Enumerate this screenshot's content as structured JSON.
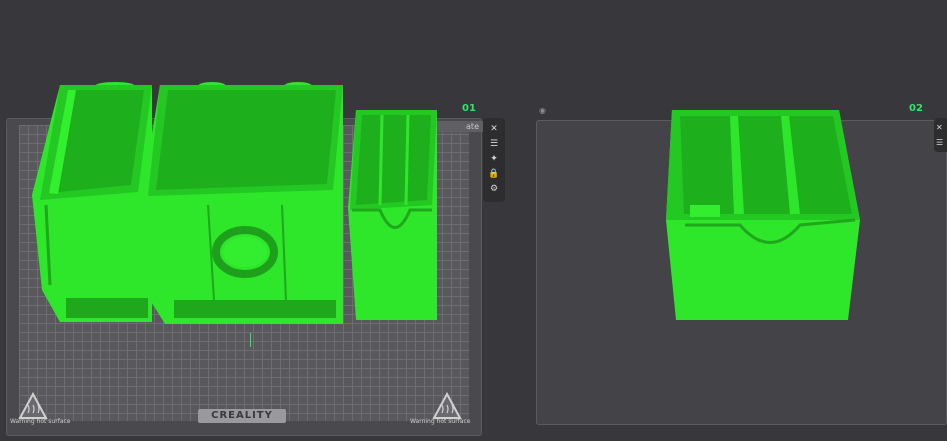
{
  "plates": [
    {
      "number": "01",
      "label": "ate"
    },
    {
      "number": "02"
    }
  ],
  "brand": "CREALITY",
  "warning_text": "Warning hot surface",
  "toolbar": {
    "icons": [
      "close-icon",
      "list-icon",
      "magic-wand-icon",
      "lock-icon",
      "settings-icon"
    ],
    "glyphs": [
      "✕",
      "☰",
      "✦",
      "🔒",
      "⚙"
    ]
  },
  "toolbar2": {
    "icons": [
      "close-icon",
      "list-icon"
    ],
    "glyphs": [
      "✕",
      "☰"
    ]
  },
  "colors": {
    "model_green": "#2ee62a",
    "model_dark": "#1fa81c",
    "plate_number": "#2ee66a",
    "background": "#38383c"
  }
}
